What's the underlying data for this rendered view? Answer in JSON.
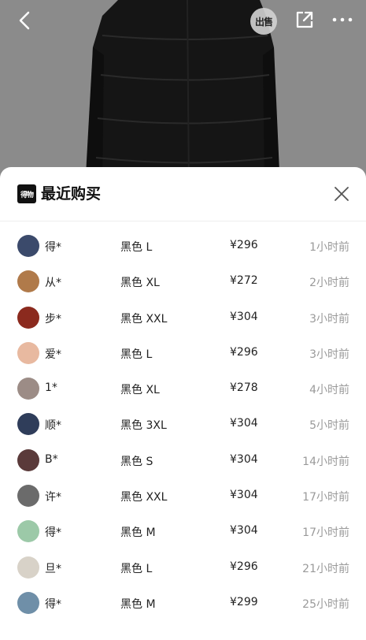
{
  "header": {
    "sell_label": "出售"
  },
  "sheet": {
    "brand_logo_text": "得物",
    "title": "最近购买"
  },
  "colors": {
    "price": "#222222",
    "time": "#9a9a9a",
    "sheet_bg": "#ffffff",
    "backdrop": "#8b8b8b"
  },
  "purchases": [
    {
      "user": "得*",
      "spec": "黑色 L",
      "price": "¥296",
      "time": "1小时前",
      "avatar_color": "#3b4a6b"
    },
    {
      "user": "从*",
      "spec": "黑色 XL",
      "price": "¥272",
      "time": "2小时前",
      "avatar_color": "#b07a4a"
    },
    {
      "user": "步*",
      "spec": "黑色 XXL",
      "price": "¥304",
      "time": "3小时前",
      "avatar_color": "#8b2a1e"
    },
    {
      "user": "爱*",
      "spec": "黑色 L",
      "price": "¥296",
      "time": "3小时前",
      "avatar_color": "#e8b9a0"
    },
    {
      "user": "1*",
      "spec": "黑色 XL",
      "price": "¥278",
      "time": "4小时前",
      "avatar_color": "#9c8c86"
    },
    {
      "user": "顺*",
      "spec": "黑色 3XL",
      "price": "¥304",
      "time": "5小时前",
      "avatar_color": "#2f3d5a"
    },
    {
      "user": "B*",
      "spec": "黑色 S",
      "price": "¥304",
      "time": "14小时前",
      "avatar_color": "#5a3a3a"
    },
    {
      "user": "许*",
      "spec": "黑色 XXL",
      "price": "¥304",
      "time": "17小时前",
      "avatar_color": "#6b6b6b"
    },
    {
      "user": "得*",
      "spec": "黑色 M",
      "price": "¥304",
      "time": "17小时前",
      "avatar_color": "#9cc9a8"
    },
    {
      "user": "旦*",
      "spec": "黑色 L",
      "price": "¥296",
      "time": "21小时前",
      "avatar_color": "#d8d2c8"
    },
    {
      "user": "得*",
      "spec": "黑色 M",
      "price": "¥299",
      "time": "25小时前",
      "avatar_color": "#6f8fa8"
    }
  ]
}
